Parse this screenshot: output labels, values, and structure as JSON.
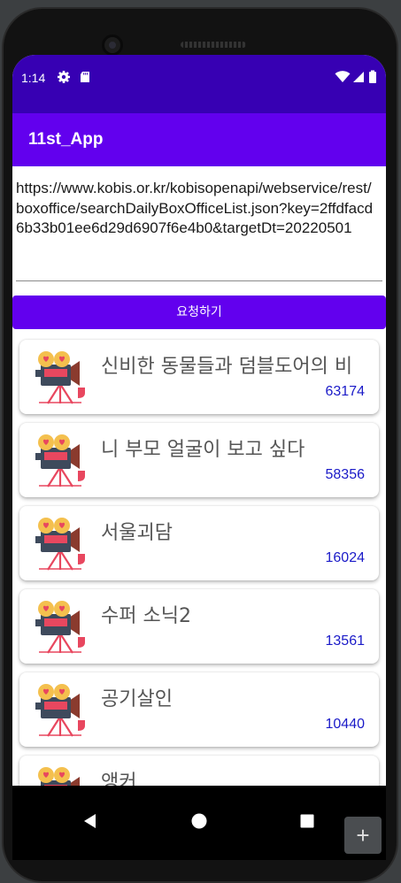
{
  "status": {
    "time": "1:14"
  },
  "app": {
    "title": "11st_App"
  },
  "request": {
    "url": "https://www.kobis.or.kr/kobisopenapi/webservice/rest/boxoffice/searchDailyBoxOfficeList.json?key=2ffdfacd6b33b01ee6d29d6907f6e4b0&targetDt=20220501",
    "button_label": "요청하기"
  },
  "movies": [
    {
      "title": "신비한 동물들과 덤블도어의 비",
      "count": "63174"
    },
    {
      "title": "니 부모 얼굴이 보고 싶다",
      "count": "58356"
    },
    {
      "title": "서울괴담",
      "count": "16024"
    },
    {
      "title": "수퍼 소닉2",
      "count": "13561"
    },
    {
      "title": "공기살인",
      "count": "10440"
    },
    {
      "title": "앵커",
      "count": ""
    }
  ],
  "emulator": {
    "plus_label": "+"
  },
  "colors": {
    "status_bar": "#3700b3",
    "primary": "#6200ee",
    "count_text": "#1a1ac8"
  }
}
